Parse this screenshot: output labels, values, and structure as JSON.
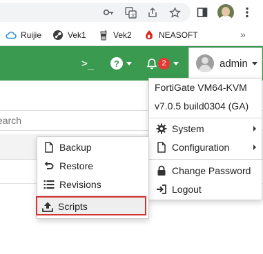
{
  "browser": {
    "icons": [
      "key-icon",
      "translate-icon",
      "share-icon",
      "star-icon",
      "sidebar-icon",
      "profile-avatar",
      "kebab-menu-icon"
    ],
    "bookmarks": [
      {
        "label": "Ruijie",
        "icon": "cloud-icon"
      },
      {
        "label": "Vek1",
        "icon": "steam-icon"
      },
      {
        "label": "Vek2",
        "icon": "drink-icon"
      },
      {
        "label": "NEASOFT",
        "icon": "neasoft-logo-icon"
      }
    ],
    "more": "»"
  },
  "header": {
    "cli_icon": ">_",
    "help_icon": "?",
    "notifications_count": "2",
    "admin_label": "admin",
    "accent": "#3a9a4f"
  },
  "content": {
    "search_placeholder": "earch"
  },
  "admin_menu": {
    "product": "FortiGate VM64-KVM",
    "version": "v7.0.5 build0304 (GA)",
    "items": [
      {
        "label": "System",
        "icon": "gear-icon",
        "submenu": true
      },
      {
        "label": "Configuration",
        "icon": "document-icon",
        "submenu": true
      },
      {
        "label": "Change Password",
        "icon": "lock-icon"
      },
      {
        "label": "Logout",
        "icon": "logout-icon"
      }
    ]
  },
  "config_menu": {
    "items": [
      {
        "label": "Backup",
        "icon": "document-icon"
      },
      {
        "label": "Restore",
        "icon": "undo-icon"
      },
      {
        "label": "Revisions",
        "icon": "list-icon"
      },
      {
        "label": "Scripts",
        "icon": "upload-icon",
        "highlighted": true
      }
    ],
    "highlight_color": "#d3342f"
  }
}
